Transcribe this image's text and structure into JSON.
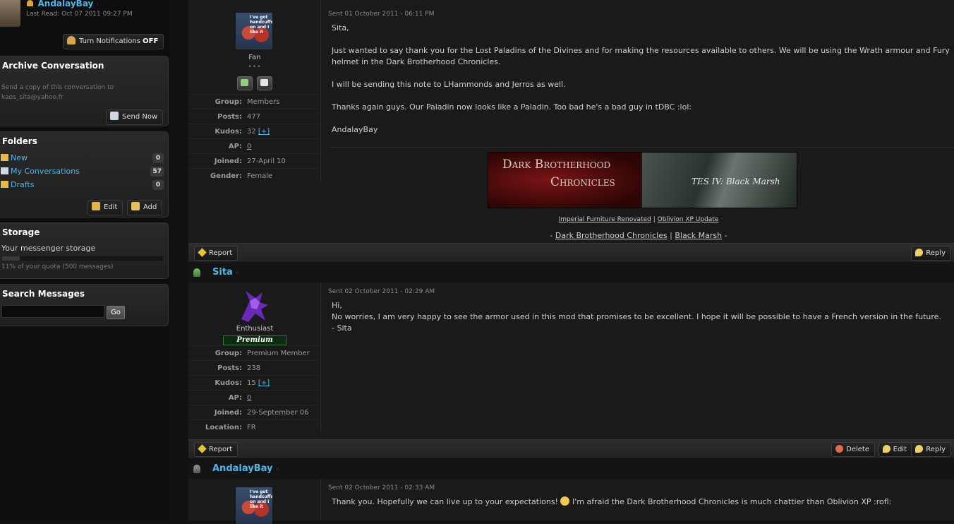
{
  "header": {
    "username": "AndalayBay",
    "last_read": "Last Read: Oct 07 2011 09:27 PM",
    "notifications_button": "Turn Notifications",
    "notifications_state": "OFF"
  },
  "archive": {
    "title": "Archive Conversation",
    "description": "Send a copy of this conversation to kaos_sita@yahoo.fr",
    "send_button": "Send Now"
  },
  "folders": {
    "title": "Folders",
    "items": [
      {
        "label": "New",
        "count": "0"
      },
      {
        "label": "My Conversations",
        "count": "57"
      },
      {
        "label": "Drafts",
        "count": "0"
      }
    ],
    "edit_button": "Edit",
    "add_button": "Add"
  },
  "storage": {
    "title": "Storage",
    "label": "Your messenger storage",
    "quota_text": "11% of your quota (500 messages)",
    "quota_percent": 11
  },
  "search": {
    "title": "Search Messages",
    "go_button": "Go",
    "query": ""
  },
  "messages": [
    {
      "author": "AndalayBay",
      "avatar_caption": "I've got handcuffs on and I like it",
      "rank": "Fan",
      "dots": "•••",
      "sent": "Sent 01 October 2011 - 06:11 PM",
      "info": [
        {
          "k": "Group:",
          "v": "Members"
        },
        {
          "k": "Posts:",
          "v": "477"
        },
        {
          "k": "Kudos:",
          "v": "32",
          "extra": "[+]"
        },
        {
          "k": "AP:",
          "v": "0"
        },
        {
          "k": "Joined:",
          "v": "27-April 10"
        },
        {
          "k": "Gender:",
          "v": "Female"
        }
      ],
      "body": [
        "Sita,",
        "Just wanted to say thank you for the Lost Paladins of the Divines and for making the resources available to others. We will be using the Wrath armour and Fury helmet in the Dark Brotherhood Chronicles.",
        "I will be sending this note to LHammonds and Jerros as well.",
        "Thanks again guys. Our Paladin now looks like a Paladin. Too bad he's a bad guy in tDBC :lol:",
        "AndalayBay"
      ],
      "banner": {
        "left_line1": "Dark Brotherhood",
        "left_line2": "Chronicles",
        "right_text": "TES IV: Black Marsh"
      },
      "sig_links1": [
        "Imperial Furniture Renovated",
        "|",
        "Oblivion XP Update"
      ],
      "sig_links2": [
        "-",
        "Dark Brotherhood Chronicles",
        "|",
        "Black Marsh",
        "-"
      ],
      "actions": [
        "Report",
        "Reply"
      ]
    },
    {
      "author": "Sita",
      "rank": "Enthusiast",
      "badge": "Premium",
      "sent": "Sent 02 October 2011 - 02:29 AM",
      "info": [
        {
          "k": "Group:",
          "v": "Premium Member"
        },
        {
          "k": "Posts:",
          "v": "238"
        },
        {
          "k": "Kudos:",
          "v": "15",
          "extra": "[+]"
        },
        {
          "k": "AP:",
          "v": "0"
        },
        {
          "k": "Joined:",
          "v": "29-September 06"
        },
        {
          "k": "Location:",
          "v": "FR"
        }
      ],
      "body": [
        "Hi,",
        "No worries, I am very happy to see the armor used in this mod that promises to be excellent. I hope it will be possible to have a French version in the future.",
        "- Sita"
      ],
      "actions": [
        "Report",
        "Delete",
        "Edit",
        "Reply"
      ]
    },
    {
      "author": "AndalayBay",
      "avatar_caption": "I've got handcuffs on and I like it",
      "sent": "Sent 02 October 2011 - 02:33 AM",
      "body_start": "Thank you. Hopefully we can live up to your expectations!",
      "body_end": "I'm afraid the Dark Brotherhood Chronicles is much chattier than Oblivion XP :rofl:"
    }
  ]
}
